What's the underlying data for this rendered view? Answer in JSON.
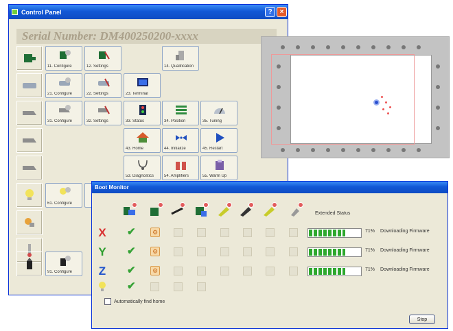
{
  "control_panel": {
    "title": "Control Panel",
    "serial": "Serial Number: DM400250200-xxxx",
    "help_label": "?",
    "close_label": "×",
    "buttons": [
      {
        "label": "11. Configure"
      },
      {
        "label": "12. Settings"
      },
      {
        "label": "14. Qualification"
      },
      {
        "label": "21. Configure"
      },
      {
        "label": "22. Settings"
      },
      {
        "label": "23. Terminal"
      },
      {
        "label": "31. Configure"
      },
      {
        "label": "32. Settings"
      },
      {
        "label": "33. Status"
      },
      {
        "label": "34. Position"
      },
      {
        "label": "35. Tuning"
      },
      {
        "label": "43. Home"
      },
      {
        "label": "44. Initialize"
      },
      {
        "label": "45. Restart"
      },
      {
        "label": "53. Diagnostics"
      },
      {
        "label": "54. Amplifiers"
      },
      {
        "label": "55. Warm Up"
      },
      {
        "label": "61. Configure"
      },
      {
        "label": "91. Configure"
      }
    ]
  },
  "boot_monitor": {
    "title": "Boot Monitor",
    "extended_status_label": "Extended Status",
    "axes": [
      {
        "name": "X",
        "color": "#d93030",
        "progress": 0.71,
        "pct": "71%",
        "status": "Downloading Firmware"
      },
      {
        "name": "Y",
        "color": "#2e9e2e",
        "progress": 0.71,
        "pct": "71%",
        "status": "Downloading Firmware"
      },
      {
        "name": "Z",
        "color": "#2255cc",
        "progress": 0.71,
        "pct": "71%",
        "status": "Downloading Firmware"
      }
    ],
    "checkbox_label": "Automatically find home",
    "stop_label": "Stop"
  },
  "colors": {
    "title_bar": "#1258d6",
    "window_bg": "#ece9d8",
    "progress": "#2ea82e"
  }
}
